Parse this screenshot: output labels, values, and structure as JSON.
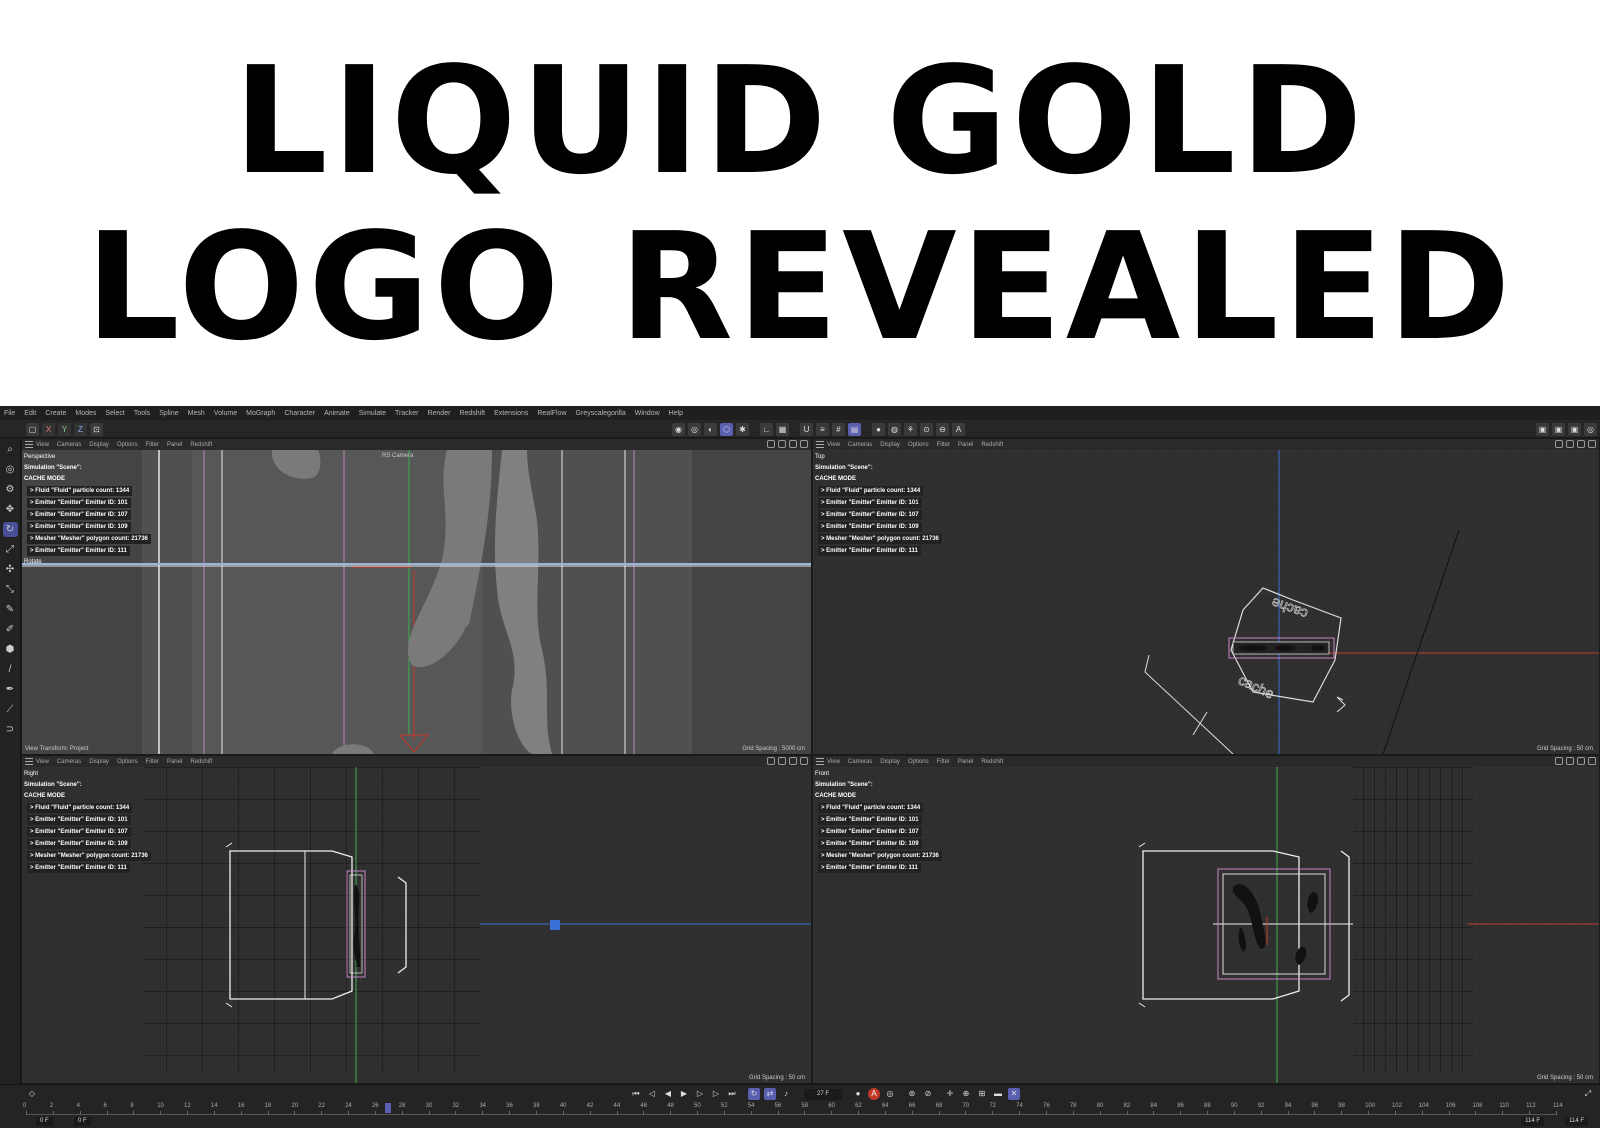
{
  "headline": {
    "line1": "LIQUID GOLD",
    "line2": "LOGO REVEALED"
  },
  "menubar": [
    "File",
    "Edit",
    "Create",
    "Modes",
    "Select",
    "Tools",
    "Spline",
    "Mesh",
    "Volume",
    "MoGraph",
    "Character",
    "Animate",
    "Simulate",
    "Tracker",
    "Render",
    "Redshift",
    "Extensions",
    "RealFlow",
    "Greyscalegorilla",
    "Window",
    "Help"
  ],
  "toolbar": {
    "axes": [
      "X",
      "Y",
      "Z"
    ]
  },
  "viewport_menu": [
    "View",
    "Cameras",
    "Display",
    "Options",
    "Filter",
    "Panel",
    "Redshift"
  ],
  "hud": {
    "simulation": "Simulation \"Scene\":",
    "cache_mode": "CACHE MODE",
    "items": [
      "> Fluid \"Fluid\" particle count: 1344",
      "> Emitter \"Emitter\" Emitter ID: 101",
      "> Emitter \"Emitter\" Emitter ID: 107",
      "> Emitter \"Emitter\" Emitter ID: 109",
      "> Mesher \"Mesher\" polygon count: 21736",
      "> Emitter \"Emitter\" Emitter ID: 111"
    ]
  },
  "viewports": {
    "perspective": {
      "name": "Perspective",
      "extra": "Rotate",
      "grid": "Grid Spacing : 5000 cm",
      "view_transform": "View Transform: Project",
      "camera": "RS Camera"
    },
    "top": {
      "name": "Top",
      "grid": "Grid Spacing : 50 cm",
      "label_text": "cache"
    },
    "right": {
      "name": "Right",
      "grid": "Grid Spacing : 50 cm"
    },
    "front": {
      "name": "Front",
      "grid": "Grid Spacing : 50 cm"
    }
  },
  "timeline": {
    "current_frame": "27 F",
    "start_field": "0 F",
    "start_field2": "0 F",
    "end_field": "114 F",
    "end_field2": "114 F",
    "playhead_frame": 27,
    "ticks": [
      "0",
      "2",
      "4",
      "6",
      "8",
      "10",
      "12",
      "14",
      "16",
      "18",
      "20",
      "22",
      "24",
      "26",
      "28",
      "30",
      "32",
      "34",
      "36",
      "38",
      "40",
      "42",
      "44",
      "46",
      "48",
      "50",
      "52",
      "54",
      "56",
      "58",
      "60",
      "62",
      "64",
      "66",
      "68",
      "70",
      "72",
      "74",
      "76",
      "78",
      "80",
      "82",
      "84",
      "86",
      "88",
      "90",
      "92",
      "94",
      "96",
      "98",
      "100",
      "102",
      "104",
      "106",
      "108",
      "110",
      "112",
      "114"
    ]
  },
  "colors": {
    "accent": "#5a5fb0",
    "axis_green": "#3fae4f",
    "axis_red": "#c0392b",
    "axis_blue": "#3a6fd8",
    "selection_pink": "#c884c8"
  }
}
